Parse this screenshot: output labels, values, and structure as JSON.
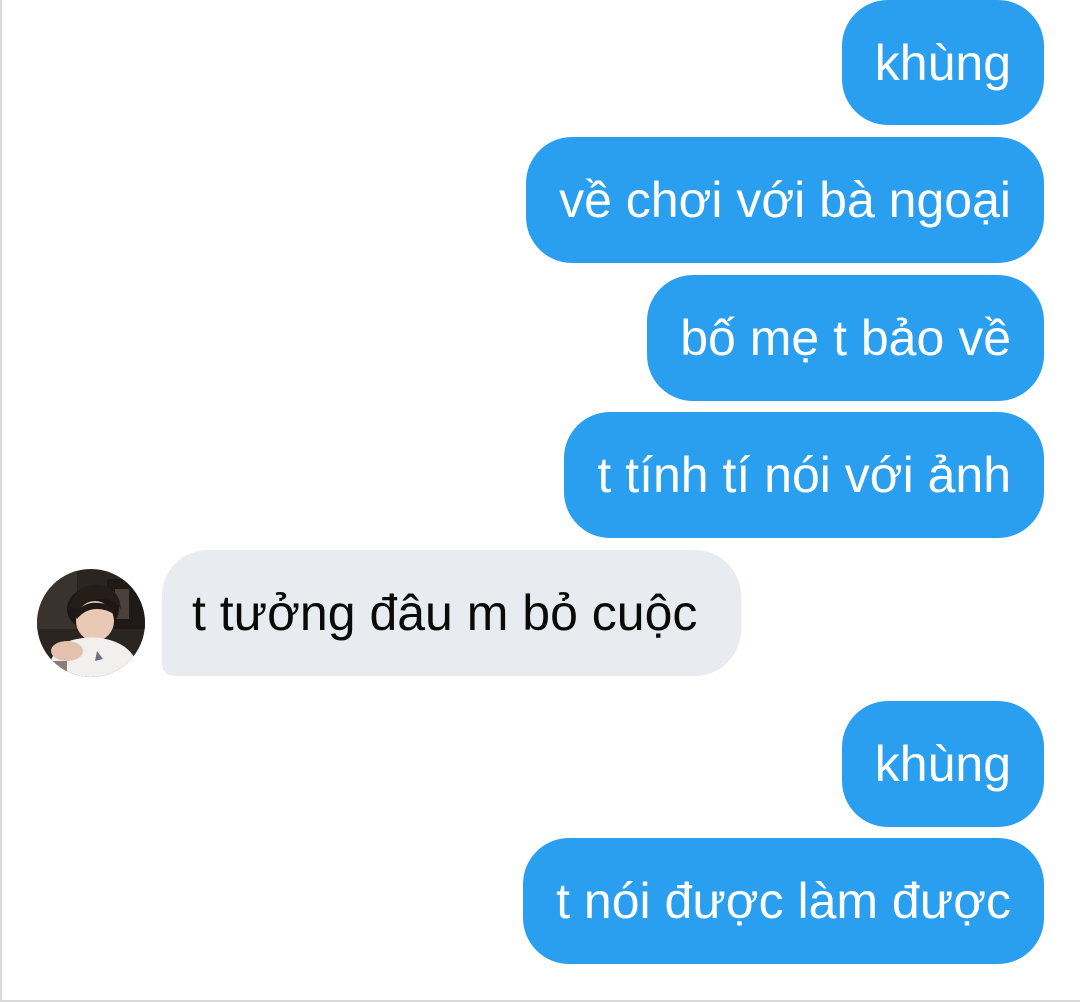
{
  "messages": [
    {
      "direction": "outgoing",
      "text": "khùng"
    },
    {
      "direction": "outgoing",
      "text": "về chơi với bà ngoại"
    },
    {
      "direction": "outgoing",
      "text": "bố mẹ t bảo về"
    },
    {
      "direction": "outgoing",
      "text": "t tính tí nói với ảnh"
    },
    {
      "direction": "incoming",
      "text": "t tưởng đâu m bỏ cuộc",
      "avatar": "person-photo-avatar"
    },
    {
      "direction": "outgoing",
      "text": "khùng"
    },
    {
      "direction": "outgoing",
      "text": "t nói được làm được"
    }
  ],
  "colors": {
    "outgoing_bubble": "#2a9ff0",
    "outgoing_text": "#ffffff",
    "incoming_bubble": "#e8ebef",
    "incoming_text": "#0a0a0a",
    "background": "#ffffff"
  }
}
